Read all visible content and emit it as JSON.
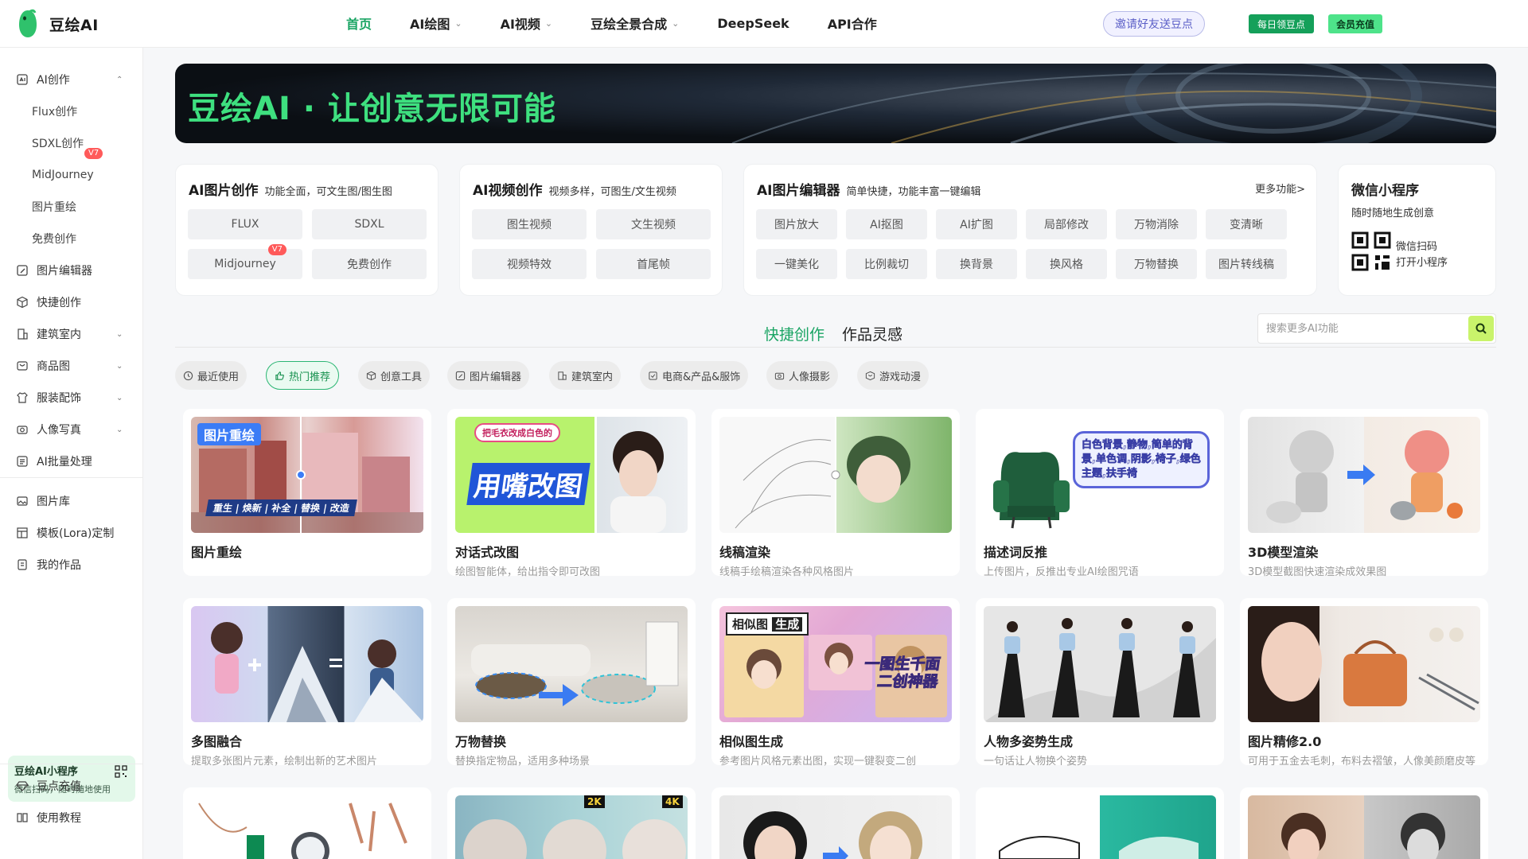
{
  "brand": {
    "name": "豆绘AI"
  },
  "nav": {
    "items": [
      {
        "label": "首页",
        "has_dropdown": false,
        "active": true
      },
      {
        "label": "AI绘图",
        "has_dropdown": true
      },
      {
        "label": "AI视频",
        "has_dropdown": true
      },
      {
        "label": "豆绘全景合成",
        "has_dropdown": true
      },
      {
        "label": "DeepSeek",
        "has_dropdown": false
      },
      {
        "label": "API合作",
        "has_dropdown": false
      }
    ],
    "invite": "邀请好友送豆点",
    "daily": "每日领豆点",
    "vip": "会员充值"
  },
  "sidebar": {
    "groups": [
      {
        "label": "AI创作",
        "icon": "ai-create-icon",
        "expanded": true
      },
      {
        "label": "图片编辑器",
        "icon": "image-edit-icon"
      },
      {
        "label": "快捷创作",
        "icon": "cube-icon"
      },
      {
        "label": "建筑室内",
        "icon": "building-icon",
        "expandable": true
      },
      {
        "label": "商品图",
        "icon": "product-icon",
        "expandable": true
      },
      {
        "label": "服装配饰",
        "icon": "shirt-icon",
        "expandable": true
      },
      {
        "label": "人像写真",
        "icon": "camera-icon",
        "expandable": true
      },
      {
        "label": "AI批量处理",
        "icon": "batch-icon"
      },
      {
        "label": "图片库",
        "icon": "gallery-icon"
      },
      {
        "label": "模板(Lora)定制",
        "icon": "template-icon"
      },
      {
        "label": "我的作品",
        "icon": "works-icon"
      },
      {
        "label": "豆点充值",
        "icon": "diamond-icon"
      },
      {
        "label": "使用教程",
        "icon": "book-icon"
      }
    ],
    "sub_items": [
      "Flux创作",
      "SDXL创作",
      "MidJourney",
      "图片重绘",
      "免费创作"
    ],
    "mj_badge": "V7",
    "mini_program": {
      "title": "豆绘AI小程序",
      "subtitle": "微信扫码，随时随地使用"
    }
  },
  "banner": {
    "title": "豆绘AI · 让创意无限可能"
  },
  "cards": {
    "image_create": {
      "title": "AI图片创作",
      "subtitle": "功能全面，可文生图/图生图",
      "buttons": [
        "FLUX",
        "SDXL",
        "Midjourney",
        "免费创作"
      ],
      "badge": "V7"
    },
    "video_create": {
      "title": "AI视频创作",
      "subtitle": "视频多样，可图生/文生视频",
      "buttons": [
        "图生视频",
        "文生视频",
        "视频特效",
        "首尾帧"
      ]
    },
    "image_editor": {
      "title": "AI图片编辑器",
      "subtitle": "简单快捷，功能丰富一键编辑",
      "more": "更多功能>",
      "buttons": [
        "图片放大",
        "AI抠图",
        "AI扩图",
        "局部修改",
        "万物消除",
        "变清晰",
        "一键美化",
        "比例裁切",
        "换背景",
        "换风格",
        "万物替换",
        "图片转线稿"
      ]
    },
    "wechat": {
      "title": "微信小程序",
      "subtitle": "随时随地生成创意",
      "line1": "微信扫码",
      "line2": "打开小程序"
    }
  },
  "section": {
    "tabs": [
      "快捷创作",
      "作品灵感"
    ],
    "active_tab": 0
  },
  "search": {
    "placeholder": "搜索更多AI功能"
  },
  "filters": [
    {
      "label": "最近使用",
      "icon": "clock-icon"
    },
    {
      "label": "热门推荐",
      "icon": "thumbs-up-icon",
      "active": true
    },
    {
      "label": "创意工具",
      "icon": "box-icon"
    },
    {
      "label": "图片编辑器",
      "icon": "image-edit-icon"
    },
    {
      "label": "建筑室内",
      "icon": "building-icon"
    },
    {
      "label": "电商&产品&服饰",
      "icon": "shop-icon"
    },
    {
      "label": "人像摄影",
      "icon": "camera-icon"
    },
    {
      "label": "游戏动漫",
      "icon": "game-icon"
    }
  ],
  "tools": [
    {
      "title": "图片重绘",
      "desc": "",
      "tag": "图片重绘",
      "caption": "重生 | 焕新 | 补全 | 替换 | 改造"
    },
    {
      "title": "对话式改图",
      "desc": "绘图智能体，给出指令即可改图",
      "bubble": "把毛衣改成白色的",
      "big": "用嘴改图"
    },
    {
      "title": "线稿渲染",
      "desc": "线稿手绘稿渲染各种风格图片"
    },
    {
      "title": "描述词反推",
      "desc": "上传图片，反推出专业AI绘图咒语",
      "bubble": "白色背景,静物,简单的背景,单色调,阴影,椅子,绿色主题,扶手椅"
    },
    {
      "title": "3D模型渲染",
      "desc": "3D模型截图快速渲染成效果图"
    },
    {
      "title": "多图融合",
      "desc": "提取多张图片元素，绘制出新的艺术图片"
    },
    {
      "title": "万物替换",
      "desc": "替换指定物品，适用多种场景"
    },
    {
      "title": "相似图生成",
      "desc": "参考图片风格元素出图，实现一键裂变二创",
      "tag1": "相似图",
      "tag2": "生成",
      "big": "一图生千面 二创神器"
    },
    {
      "title": "人物多姿势生成",
      "desc": "一句话让人物换个姿势"
    },
    {
      "title": "图片精修2.0",
      "desc": "可用于五金去毛刺，布料去褶皱，人像美颜磨皮等"
    }
  ],
  "row3_badges": {
    "b2k": "2K",
    "b4k": "4K"
  }
}
